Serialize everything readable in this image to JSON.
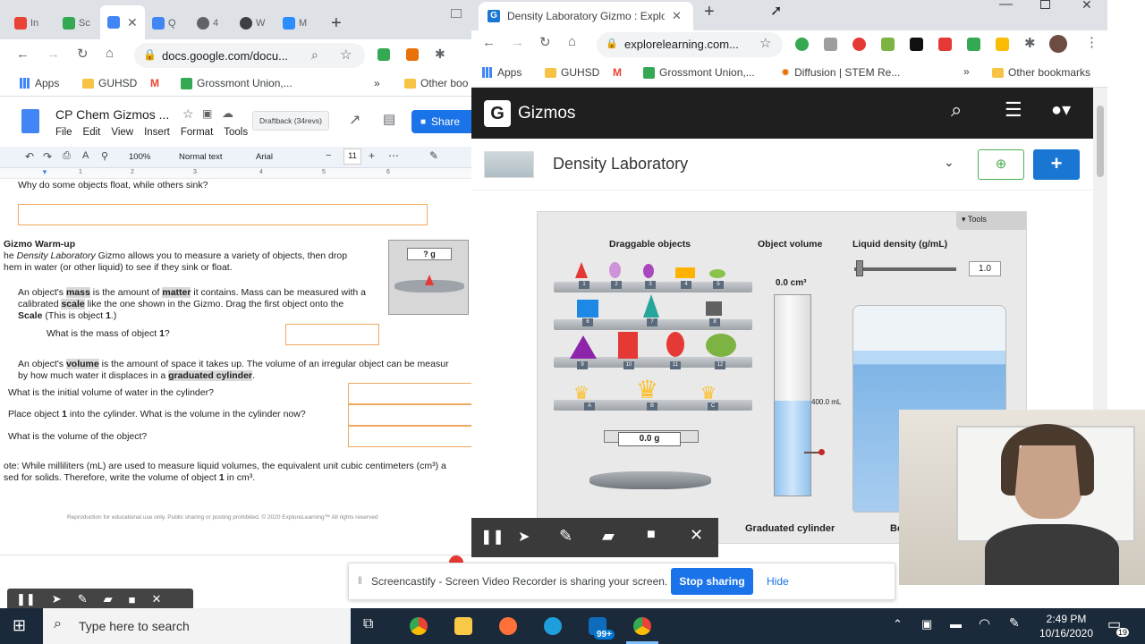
{
  "left_browser": {
    "tabs": [
      {
        "label": "In",
        "color": "#ea4335"
      },
      {
        "label": "Sc",
        "color": "#34a853"
      },
      {
        "label": "",
        "color": "#4285f4",
        "active": true
      },
      {
        "label": "Q",
        "color": "#4285f4"
      },
      {
        "label": "4",
        "color": "#5f6368"
      },
      {
        "label": "W",
        "color": "#3c4043"
      },
      {
        "label": "M",
        "color": "#2d8cff"
      }
    ],
    "url": "docs.google.com/docu...",
    "bookmarks": [
      "Apps",
      "GUHSD",
      "Grossmont Union,...",
      "Other boo"
    ],
    "doc_title": "CP Chem Gizmos ...",
    "menu": [
      "File",
      "Edit",
      "View",
      "Insert",
      "Format",
      "Tools"
    ],
    "draftback": "Draftback (34revs)",
    "share_label": "Share",
    "toolbar": {
      "zoom": "100%",
      "style": "Normal text",
      "font": "Arial",
      "size": "11"
    },
    "ruler": [
      "1",
      "2",
      "3",
      "4",
      "5",
      "6"
    ],
    "doc": {
      "q_float": "Why do some objects float, while others sink?",
      "warmup_heading": "Gizmo Warm-up",
      "intro_pre": "he ",
      "intro_italic": "Density Laboratory",
      "intro_post": " Gizmo allows you to measure a variety of objects, then drop",
      "intro_line2": "hem in water (or other liquid) to see if they sink or float.",
      "scale_reading": "? g",
      "p1_a": "An object's ",
      "p1_mass": "mass",
      "p1_b": " is the amount of ",
      "p1_matter": "matter",
      "p1_c": " it contains. Mass can be measured with a",
      "p1_d": "calibrated ",
      "p1_scale": "scale",
      "p1_e": " like the one shown in the Gizmo. Drag the first object onto the",
      "p1_f": "Scale",
      "p1_g": " (This is object ",
      "p1_h": "1",
      "p1_i": ".)",
      "q_mass_a": "What is the mass of object ",
      "q_mass_b": "1",
      "q_mass_c": "?",
      "p2_a": "An object's ",
      "p2_volume": "volume",
      "p2_b": " is the amount of space it takes up. The volume of an irregular object can be measur",
      "p2_c": "by how much water it displaces in a ",
      "p2_grad": "graduated cylinder",
      "p2_d": ".",
      "q_initial": "What is the initial volume of water in the cylinder?",
      "q_place_a": "Place object ",
      "q_place_b": "1",
      "q_place_c": " into the cylinder. What is the volume in the cylinder now?",
      "q_volume": "What is the volume of the object?",
      "note_line1": "ote: While milliliters (mL) are used to measure liquid volumes, the equivalent unit cubic centimeters (cm³) a",
      "note_line2_a": "sed for solids. Therefore, write the volume of object ",
      "note_line2_b": "1",
      "note_line2_c": " in cm³.",
      "footer": "Reproduction for educational use only. Public sharing or posting prohibited. © 2020 ExploreLearning™ All rights reserved"
    }
  },
  "right_browser": {
    "tab_title": "Density Laboratory Gizmo : Explo",
    "url": "explorelearning.com...",
    "bookmarks": [
      "Apps",
      "GUHSD",
      "Grossmont Union,...",
      "Diffusion | STEM Re...",
      "»",
      "Other bookmarks"
    ],
    "brand": "Gizmos",
    "gizmo_title": "Density Laboratory",
    "sim": {
      "tools": "Tools",
      "draggable_label": "Draggable objects",
      "volume_label": "Object volume",
      "density_label": "Liquid density (g/mL)",
      "density_value": "1.0",
      "volume_value": "0.0 cm³",
      "cylinder_mark": "400.0 mL",
      "scale_value": "0.0 g",
      "cylinder_label": "Graduated cylinder",
      "beaker_label": "Be",
      "shelf_tags": [
        [
          "1",
          "2",
          "3",
          "4",
          "5"
        ],
        [
          "6",
          "7",
          "8"
        ],
        [
          "9",
          "10",
          "11",
          "12"
        ],
        [
          "A",
          "B",
          "C"
        ]
      ]
    }
  },
  "screencastify": {
    "message": "Screencastify - Screen Video Recorder is sharing your screen.",
    "stop_label": "Stop sharing",
    "hide_label": "Hide"
  },
  "taskbar": {
    "search_placeholder": "Type here to search",
    "mail_badge": "99+",
    "time": "2:49 PM",
    "date": "10/16/2020",
    "notification_count": "19"
  },
  "colors": {
    "accent_blue": "#1a73e8",
    "gizmo_blue": "#1976d2",
    "gizmo_dark": "#1f1f1f",
    "answer_box": "#f0a860",
    "taskbar": "#1b2a3a"
  }
}
